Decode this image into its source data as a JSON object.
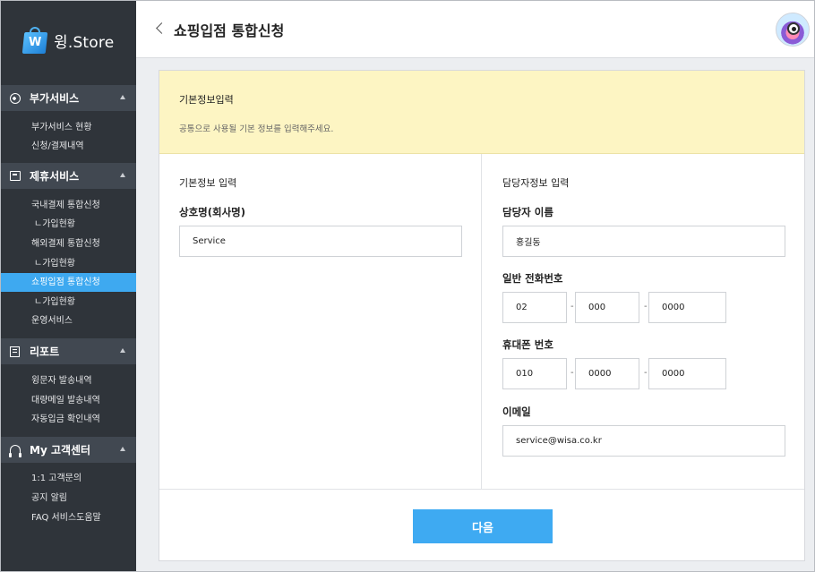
{
  "app": {
    "logo_text": "윙.Store",
    "logo_icon": "shopping-bag-icon",
    "accent": "#3ea9f0"
  },
  "header": {
    "title": "쇼핑입점 통합신청"
  },
  "sidebar": {
    "sections": [
      {
        "title": "부가서비스",
        "icon": "circle-plus-icon",
        "items": [
          "부가서비스 현황",
          "신청/결제내역"
        ]
      },
      {
        "title": "제휴서비스",
        "icon": "box-icon",
        "items": [
          "국내결제 통합신청",
          "ㄴ가입현황",
          "해외결제 통합신청",
          "ㄴ가입현황",
          "쇼핑입점 통합신청",
          "ㄴ가입현황",
          "운영서비스"
        ],
        "active_index": 4
      },
      {
        "title": "리포트",
        "icon": "document-icon",
        "items": [
          "윙문자 발송내역",
          "대량메일 발송내역",
          "자동입금 확인내역"
        ]
      },
      {
        "title": "My 고객센터",
        "icon": "headset-icon",
        "items": [
          "1:1 고객문의",
          "공지 알림",
          "FAQ 서비스도움말"
        ]
      }
    ]
  },
  "notice": {
    "title": "기본정보입력",
    "description": "공통으로 사용될 기본 정보를 입력해주세요."
  },
  "basic": {
    "section_title": "기본정보 입력",
    "company_label": "상호명(회사명)",
    "company_value": "Service"
  },
  "contact": {
    "section_title": "담당자정보 입력",
    "name_label": "담당자 이름",
    "name_value": "홍길동",
    "phone_label": "일반 전화번호",
    "phone": [
      "02",
      "000",
      "0000"
    ],
    "mobile_label": "휴대폰 번호",
    "mobile": [
      "010",
      "0000",
      "0000"
    ],
    "email_label": "이메일",
    "email_value": "service@wisa.co.kr",
    "separator": "-"
  },
  "footer": {
    "next_label": "다음"
  }
}
